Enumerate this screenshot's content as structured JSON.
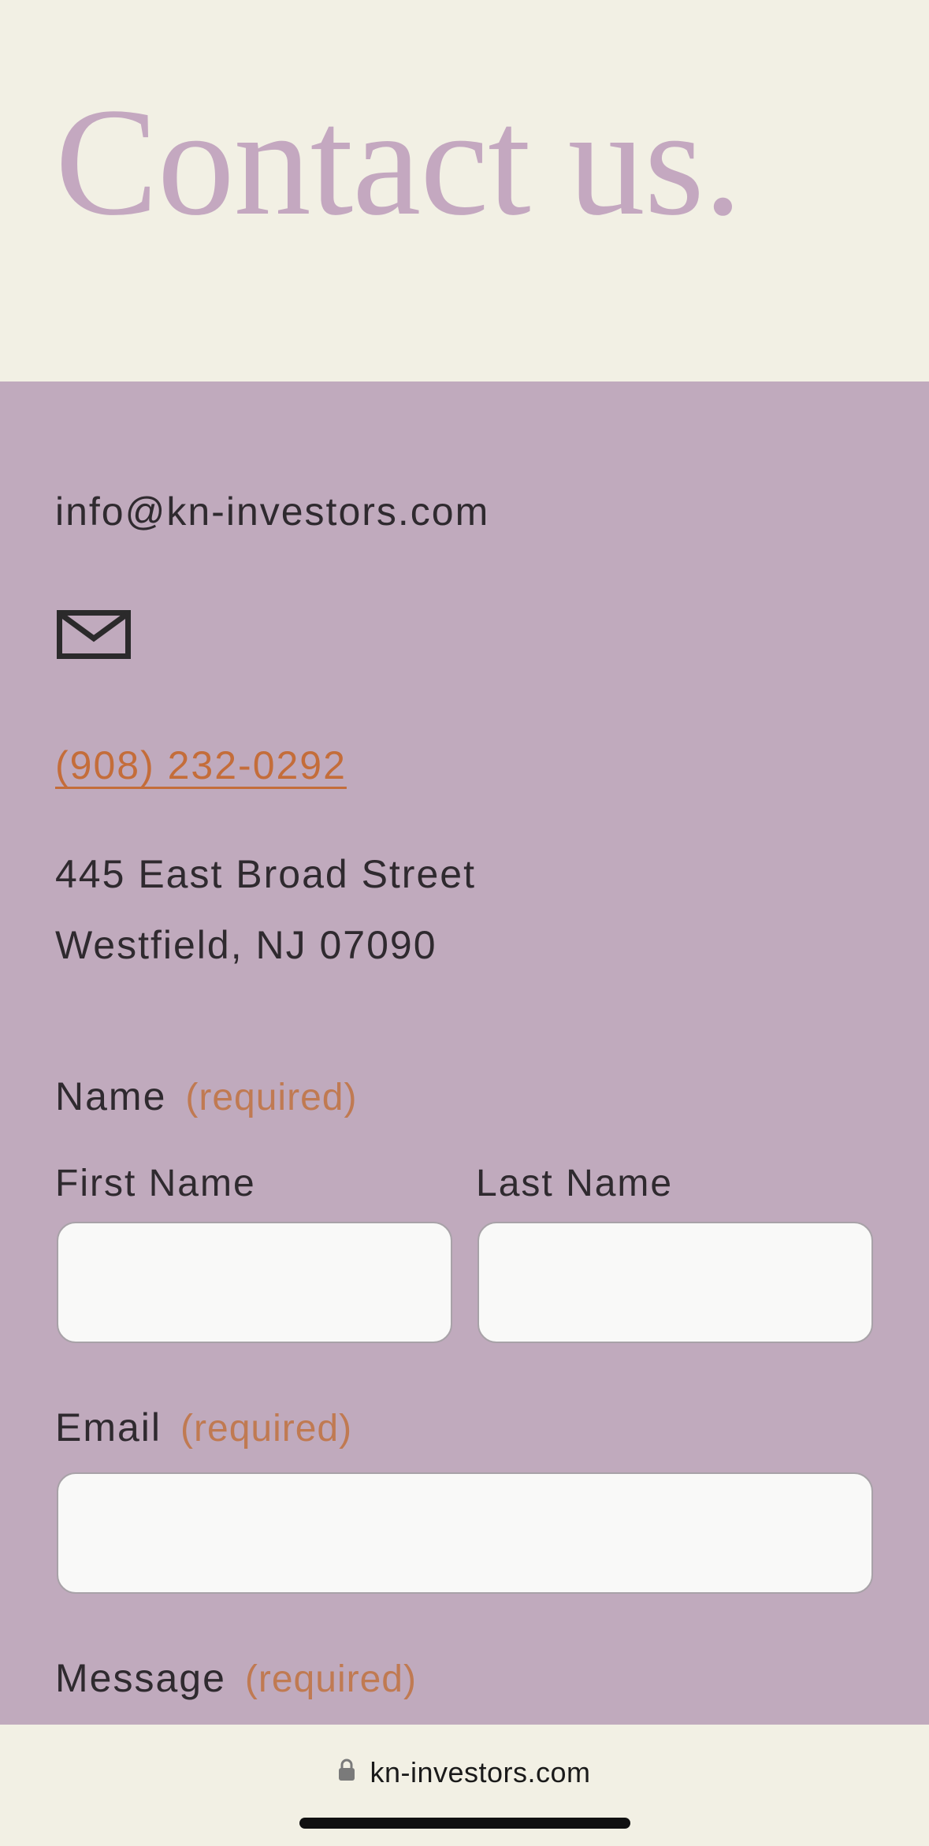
{
  "hero": {
    "title": "Contact us."
  },
  "contact": {
    "email": "info@kn-investors.com",
    "mail_icon": "envelope-icon",
    "phone": "(908) 232-0292",
    "address_line1": "445 East Broad Street",
    "address_line2": "Westfield, NJ 07090"
  },
  "form": {
    "name_label": "Name",
    "name_required": "(required)",
    "first_name_label": "First Name",
    "last_name_label": "Last Name",
    "first_name_value": "",
    "last_name_value": "",
    "email_label": "Email",
    "email_required": "(required)",
    "email_value": "",
    "message_label": "Message",
    "message_required": "(required)"
  },
  "browser": {
    "url": "kn-investors.com",
    "lock_icon": "lock-icon"
  },
  "colors": {
    "hero_background": "#f2f0e4",
    "content_background": "#c0aabd",
    "title_color": "#c4a8c0",
    "accent": "#c46d3a",
    "text": "#2f2a2f"
  }
}
